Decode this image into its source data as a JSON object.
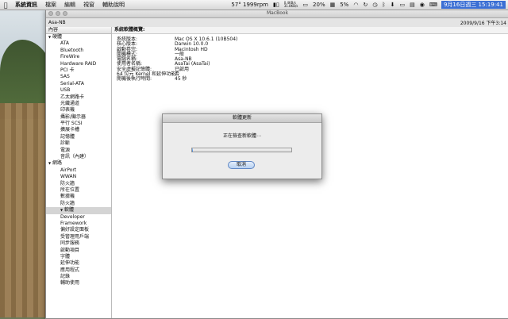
{
  "menubar": {
    "items": [
      "系統資訊",
      "檔案",
      "編輯",
      "視窗",
      "輔助說明"
    ],
    "status": {
      "temp_fan": "57° 1999rpm",
      "net_up": "0.4KB/s",
      "net_down": "31.8KB/s",
      "battery_pct": "20%",
      "volume_pct": "5%",
      "datetime": "9月16日週三  15:19:41"
    }
  },
  "window": {
    "title": "MacBook",
    "machine_name": "Asa-NB",
    "timestamp": "2009/9/16 下午3:14"
  },
  "sidebar": {
    "header": "內容",
    "groups": [
      {
        "label": "硬體",
        "items": [
          "ATA",
          "Bluetooth",
          "FireWire",
          "Hardware RAID",
          "PCI 卡",
          "SAS",
          "Serial-ATA",
          "USB",
          "乙太網路卡",
          "光纖通道",
          "印表機",
          "攝影/顯示器",
          "平行 SCSI",
          "擴展卡槽",
          "記憶體",
          "診斷",
          "電源",
          "音訊（內建）"
        ]
      },
      {
        "label": "網路",
        "items": [
          "AirPort",
          "WWAN",
          "防火牆",
          "所在位置",
          "數據機",
          "防火牆"
        ]
      },
      {
        "label": "軟體",
        "items": [
          "Developer",
          "Framework",
          "偏好設定面板",
          "受管理用戶端",
          "同步服務",
          "啟動項目",
          "字體",
          "延伸功能",
          "應用程式",
          "記錄",
          "輔助使用"
        ]
      }
    ]
  },
  "main": {
    "header": "系統軟體概覽:",
    "rows": [
      {
        "k": "系統版本:",
        "v": "Mac OS X 10.6.1 (10B504)"
      },
      {
        "k": "核心版本:",
        "v": "Darwin 10.0.0"
      },
      {
        "k": "啟動卷宗:",
        "v": "Macintosh HD"
      },
      {
        "k": "開機模式:",
        "v": "一般"
      },
      {
        "k": "電腦名稱:",
        "v": "Asa-NB"
      },
      {
        "k": "使用者名稱:",
        "v": "AsaTai (AsaTai)"
      },
      {
        "k": "安全虛擬記憶體:",
        "v": "已啟用"
      },
      {
        "k": "64 位元 Kernel 和延伸功能:",
        "v": "否"
      },
      {
        "k": "開機後執行時間:",
        "v": "45 秒"
      }
    ]
  },
  "dialog": {
    "title": "軟體更新",
    "message": "正在檢查新軟體⋯",
    "progress": 0.01,
    "cancel_label": "取消"
  }
}
